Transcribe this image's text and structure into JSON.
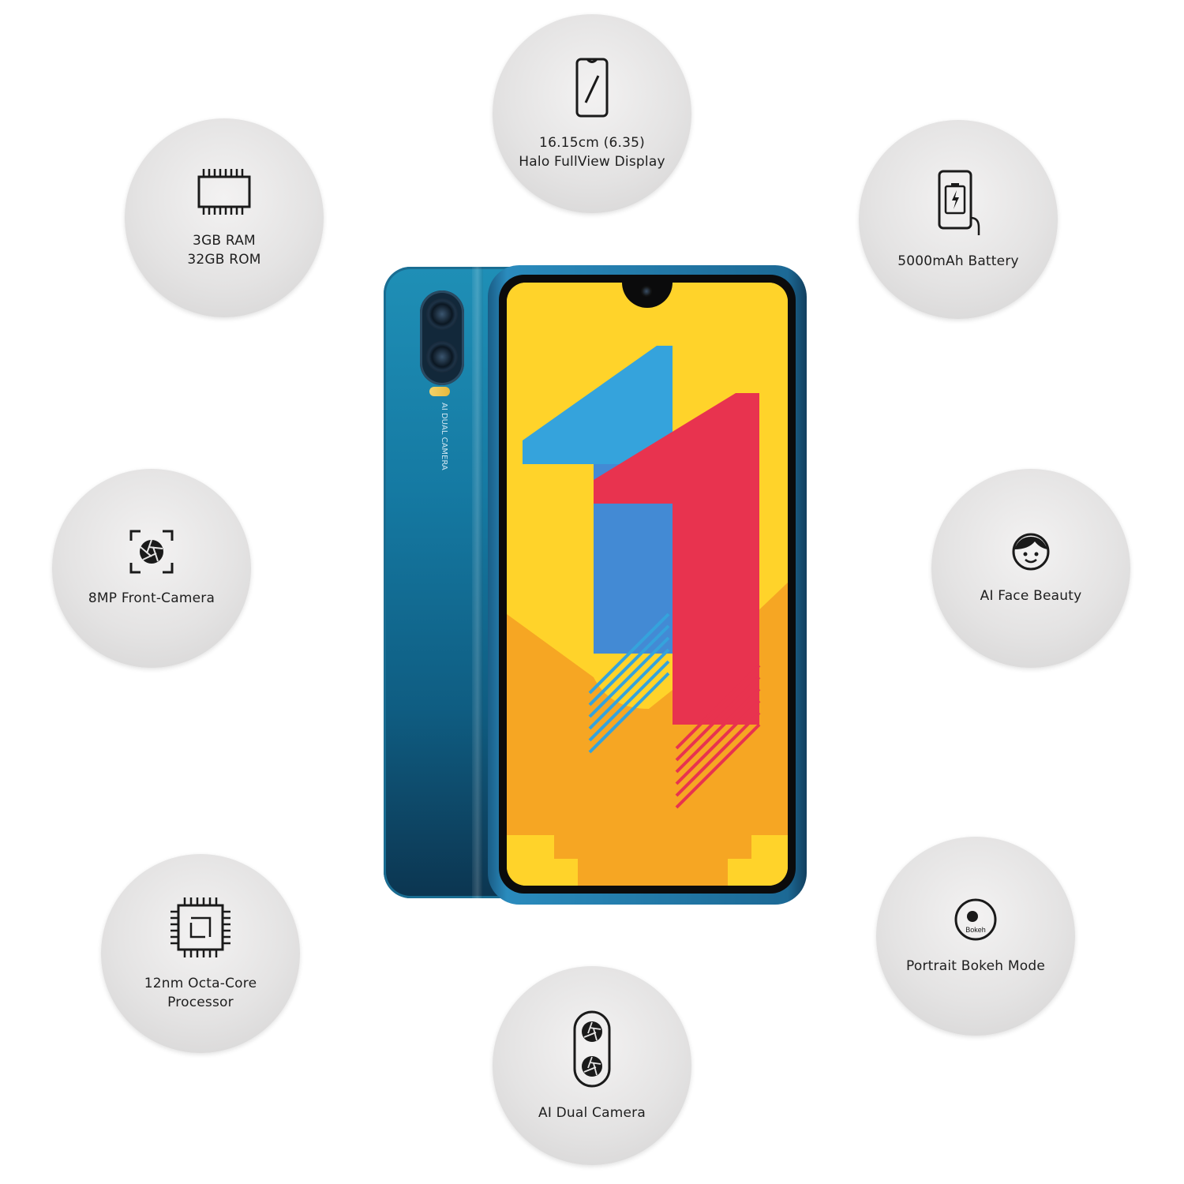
{
  "features": [
    {
      "id": "display",
      "lines": [
        "16.15cm (6.35)",
        "Halo FullView Display"
      ],
      "icon": "phone-display-icon"
    },
    {
      "id": "memory",
      "lines": [
        "3GB RAM",
        "32GB ROM"
      ],
      "icon": "memory-chip-icon"
    },
    {
      "id": "battery",
      "lines": [
        "5000mAh Battery"
      ],
      "icon": "battery-icon"
    },
    {
      "id": "front-camera",
      "lines": [
        "8MP Front-Camera"
      ],
      "icon": "aperture-icon"
    },
    {
      "id": "face-beauty",
      "lines": [
        "AI Face Beauty"
      ],
      "icon": "face-icon"
    },
    {
      "id": "processor",
      "lines": [
        "12nm Octa-Core",
        "Processor"
      ],
      "icon": "processor-chip-icon"
    },
    {
      "id": "bokeh",
      "lines": [
        "Portrait Bokeh Mode"
      ],
      "icon": "bokeh-icon",
      "icon_text": "Bokeh"
    },
    {
      "id": "dual-camera",
      "lines": [
        "AI Dual Camera"
      ],
      "icon": "dual-camera-icon"
    }
  ],
  "phone": {
    "back_text": [
      "AI DUAL",
      "CAMERA"
    ],
    "colors": {
      "body_top": "#1f8fb6",
      "body_bottom": "#0c3550",
      "screen_yellow": "#ffd32a",
      "screen_orange": "#f6a623",
      "digit_blue": "#35a3dc",
      "digit_red": "#e8334f"
    }
  }
}
